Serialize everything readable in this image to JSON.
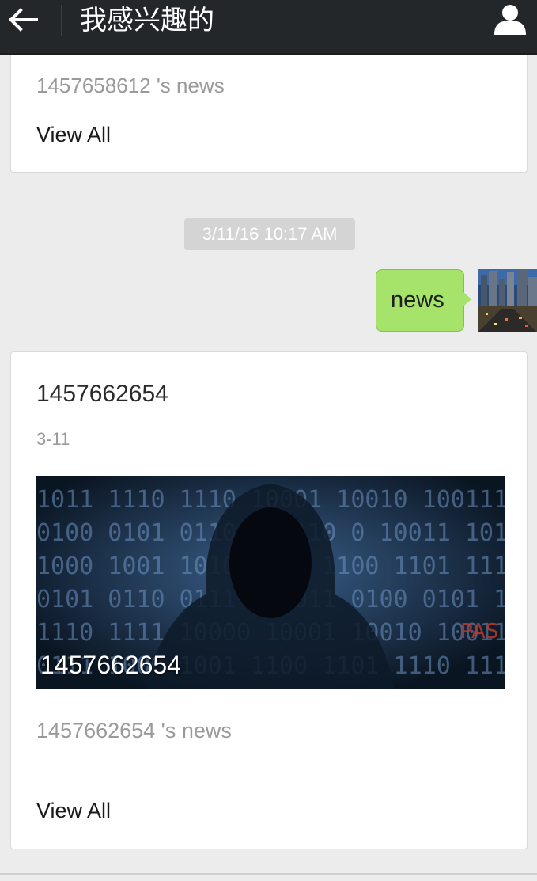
{
  "header": {
    "title": "我感兴趣的",
    "back_icon": "arrow-left-icon",
    "profile_icon": "user-profile-icon"
  },
  "cards": [
    {
      "clipped_text": "1457658612 's news",
      "view_all_label": "View All"
    },
    {
      "title": "1457662654",
      "date": "3-11",
      "image_caption": "1457662654",
      "description": "1457662654 's news",
      "view_all_label": "View All"
    }
  ],
  "chat": {
    "timestamp": "3/11/16 10:17 AM",
    "message": "news"
  },
  "colors": {
    "topbar": "#23272a",
    "bubble": "#a6e36a",
    "background": "#ececec"
  }
}
